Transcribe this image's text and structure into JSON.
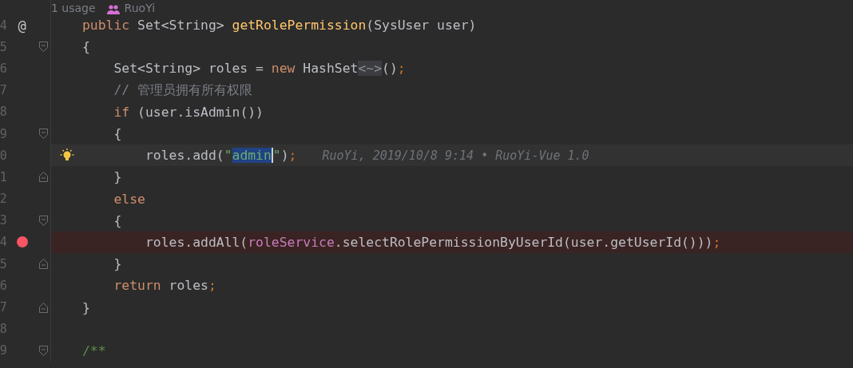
{
  "editor": {
    "hint": {
      "usages": "1 usage",
      "author": "RuoYi"
    },
    "lines": [
      {
        "number": "4",
        "implements_mark": "@",
        "tokens": [
          {
            "text": "public",
            "kind": "keyword"
          },
          {
            "text": " Set<String> ",
            "kind": "plain"
          },
          {
            "text": "getRolePermission",
            "kind": "declaration"
          },
          {
            "text": "(SysUser user)",
            "kind": "plain"
          }
        ]
      },
      {
        "number": "5",
        "fold": {
          "kind": "open"
        },
        "tokens": [
          {
            "text": "{",
            "kind": "plain"
          }
        ]
      },
      {
        "number": "6",
        "tokens": [
          {
            "text": "    Set<String> roles = ",
            "kind": "plain"
          },
          {
            "text": "new",
            "kind": "keyword"
          },
          {
            "text": " HashSet",
            "kind": "plain"
          },
          {
            "text": "<~>",
            "kind": "folded"
          },
          {
            "text": "()",
            "kind": "plain"
          },
          {
            "text": ";",
            "kind": "semicolon"
          }
        ]
      },
      {
        "number": "7",
        "tokens": [
          {
            "text": "    // 管理员拥有所有权限",
            "kind": "comment"
          }
        ]
      },
      {
        "number": "8",
        "tokens": [
          {
            "text": "    if",
            "kind": "keyword"
          },
          {
            "text": " (user.isAdmin())",
            "kind": "plain"
          }
        ]
      },
      {
        "number": "9",
        "fold": {
          "kind": "open"
        },
        "tokens": [
          {
            "text": "    {",
            "kind": "plain"
          }
        ]
      },
      {
        "number": "0",
        "bulb": true,
        "current": true,
        "blame": "RuoYi, 2019/10/8 9:14 • RuoYi-Vue 1.0",
        "tokens": [
          {
            "text": "        roles.add(",
            "kind": "plain"
          },
          {
            "text": "\"",
            "kind": "string"
          },
          {
            "text": "admin",
            "kind": "selection"
          },
          {
            "text": "\"",
            "kind": "string"
          },
          {
            "text": ")",
            "kind": "plain"
          },
          {
            "text": ";",
            "kind": "semicolon"
          }
        ]
      },
      {
        "number": "1",
        "fold": {
          "kind": "close"
        },
        "tokens": [
          {
            "text": "    }",
            "kind": "plain"
          }
        ]
      },
      {
        "number": "2",
        "tokens": [
          {
            "text": "    else",
            "kind": "keyword"
          }
        ]
      },
      {
        "number": "3",
        "fold": {
          "kind": "open"
        },
        "tokens": [
          {
            "text": "    {",
            "kind": "plain"
          }
        ]
      },
      {
        "number": "4",
        "breakpoint": true,
        "tokens": [
          {
            "text": "        roles.addAll(",
            "kind": "plain"
          },
          {
            "text": "roleService",
            "kind": "field"
          },
          {
            "text": ".selectRolePermissionByUserId(user.getUserId()))",
            "kind": "plain"
          },
          {
            "text": ";",
            "kind": "semicolon"
          }
        ]
      },
      {
        "number": "5",
        "fold": {
          "kind": "close"
        },
        "tokens": [
          {
            "text": "    }",
            "kind": "plain"
          }
        ]
      },
      {
        "number": "6",
        "tokens": [
          {
            "text": "    return",
            "kind": "keyword"
          },
          {
            "text": " roles",
            "kind": "plain"
          },
          {
            "text": ";",
            "kind": "semicolon"
          }
        ]
      },
      {
        "number": "7",
        "fold": {
          "kind": "close"
        },
        "tokens": [
          {
            "text": "}",
            "kind": "plain"
          }
        ]
      },
      {
        "number": "8"
      },
      {
        "number": "9",
        "fold": {
          "kind": "open"
        },
        "tokens": [
          {
            "text": "/**",
            "kind": "doc"
          }
        ]
      }
    ]
  }
}
